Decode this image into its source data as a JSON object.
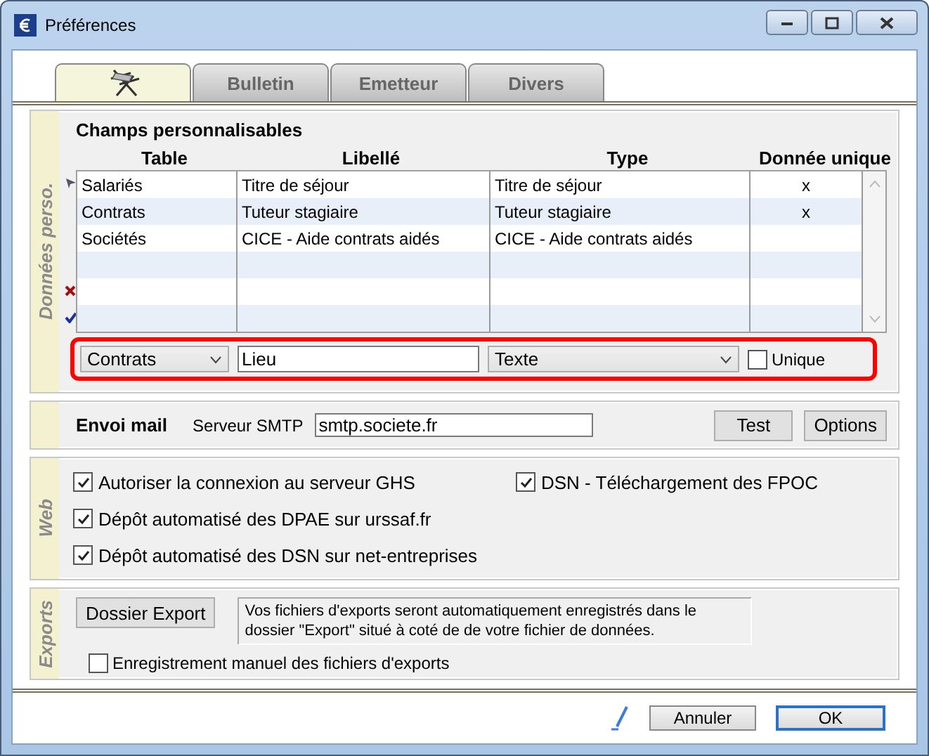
{
  "window": {
    "title": "Préférences"
  },
  "tabs": [
    {
      "kind": "icon",
      "selected": true
    },
    {
      "kind": "text",
      "label": "Bulletin",
      "selected": false
    },
    {
      "kind": "text",
      "label": "Emetteur",
      "selected": false
    },
    {
      "kind": "text",
      "label": "Divers",
      "selected": false
    }
  ],
  "custom_fields": {
    "side_label": "Données perso.",
    "title": "Champs personnalisables",
    "columns": [
      "Table",
      "Libellé",
      "Type",
      "Donnée unique"
    ],
    "rows": [
      {
        "table": "Salariés",
        "label": "Titre de séjour",
        "type": "Titre de séjour",
        "unique": "x"
      },
      {
        "table": "Contrats",
        "label": "Tuteur stagiaire",
        "type": "Tuteur stagiaire",
        "unique": "x"
      },
      {
        "table": "Sociétés",
        "label": "CICE - Aide contrats aidés",
        "type": "CICE - Aide contrats aidés"
      }
    ],
    "editor": {
      "table": "Contrats",
      "label": "Lieu",
      "type": "Texte",
      "unique_label": "Unique",
      "unique_checked": false
    }
  },
  "mail": {
    "title": "Envoi mail",
    "server_label": "Serveur SMTP",
    "server": "smtp.societe.fr",
    "buttons": [
      "Test",
      "Options"
    ]
  },
  "web": {
    "side_label": "Web",
    "options": [
      {
        "label": "Autoriser la connexion au serveur GHS",
        "checked": true
      },
      {
        "label": "Dépôt automatisé des DPAE sur urssaf.fr",
        "checked": true
      },
      {
        "label": "Dépôt automatisé des DSN sur net-entreprises",
        "checked": true
      },
      {
        "label": "DSN - Téléchargement des FPOC",
        "checked": true
      }
    ]
  },
  "exports": {
    "side_label": "Exports",
    "button": "Dossier Export",
    "note": "Vos fichiers d'exports seront automatiquement enregistrés dans le dossier \"Export\" situé à coté de de votre fichier de données.",
    "manual": {
      "label": "Enregistrement manuel des fichiers d'exports",
      "checked": false
    }
  },
  "footer": {
    "buttons": [
      "Annuler",
      "OK"
    ]
  }
}
